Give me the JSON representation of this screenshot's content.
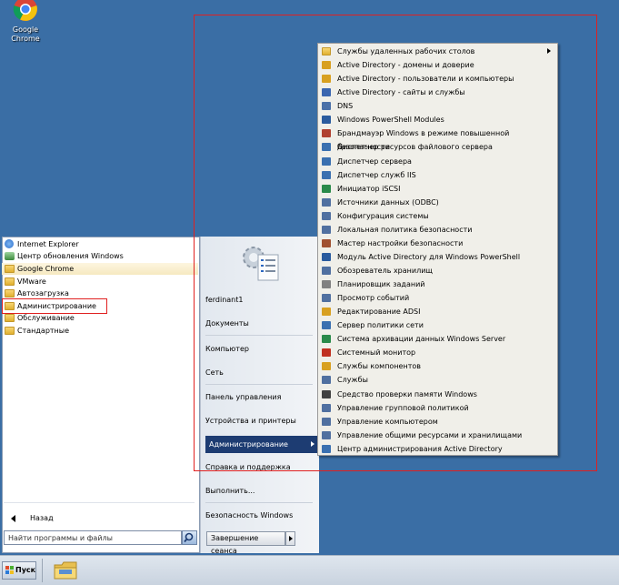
{
  "desktop": {
    "icons": [
      {
        "label": "Google\nChrome",
        "label_line1": "Google",
        "label_line2": "Chrome",
        "icon": "chrome-icon"
      }
    ]
  },
  "start_menu": {
    "programs": [
      {
        "label": "Internet Explorer",
        "icon": "ie-icon",
        "color": "#2b6fcf"
      },
      {
        "label": "Центр обновления Windows",
        "icon": "windows-update-icon",
        "color": "#3c8a3c"
      },
      {
        "label": "Google Chrome",
        "icon": "folder-icon",
        "color": "#e8c050"
      },
      {
        "label": "VMware",
        "icon": "folder-icon",
        "color": "#e8c050"
      },
      {
        "label": "Автозагрузка",
        "icon": "folder-icon",
        "color": "#e8c050"
      },
      {
        "label": "Администрирование",
        "icon": "folder-icon",
        "color": "#e8c050"
      },
      {
        "label": "Обслуживание",
        "icon": "folder-icon",
        "color": "#e8c050"
      },
      {
        "label": "Стандартные",
        "icon": "folder-icon",
        "color": "#e8c050"
      }
    ],
    "back_label": "Назад",
    "search_placeholder": "Найти программы и файлы",
    "right_items": [
      "ferdinant1",
      "Документы",
      "Компьютер",
      "Сеть",
      "Панель управления",
      "Устройства и принтеры",
      "Администрирование",
      "Справка и поддержка",
      "Выполнить...",
      "Безопасность Windows"
    ],
    "shutdown_label": "Завершение сеанса"
  },
  "submenu": {
    "items": [
      {
        "label": "Службы удаленных рабочих столов",
        "icon": "folder-icon",
        "color": "#e8c050",
        "has_arrow": true
      },
      {
        "label": "Active Directory - домены и доверие",
        "icon": "ad-domains-icon",
        "color": "#d8a020"
      },
      {
        "label": "Active Directory - пользователи и компьютеры",
        "icon": "ad-users-icon",
        "color": "#d8a020"
      },
      {
        "label": "Active Directory - сайты и службы",
        "icon": "ad-sites-icon",
        "color": "#3a66b0"
      },
      {
        "label": "DNS",
        "icon": "dns-icon",
        "color": "#4a70a8"
      },
      {
        "label": "Windows PowerShell Modules",
        "icon": "powershell-icon",
        "color": "#2a5b9e"
      },
      {
        "label": "Брандмауэр Windows в режиме повышенной безопасности",
        "icon": "firewall-icon",
        "color": "#b04030"
      },
      {
        "label": "Диспетчер ресурсов файлового сервера",
        "icon": "file-server-icon",
        "color": "#3a70b0"
      },
      {
        "label": "Диспетчер сервера",
        "icon": "server-manager-icon",
        "color": "#3a70b0"
      },
      {
        "label": "Диспетчер служб IIS",
        "icon": "iis-icon",
        "color": "#3a70b0"
      },
      {
        "label": "Инициатор iSCSI",
        "icon": "iscsi-icon",
        "color": "#2a8a4a"
      },
      {
        "label": "Источники данных (ODBC)",
        "icon": "odbc-icon",
        "color": "#5070a0"
      },
      {
        "label": "Конфигурация системы",
        "icon": "msconfig-icon",
        "color": "#5070a0"
      },
      {
        "label": "Локальная политика безопасности",
        "icon": "local-security-icon",
        "color": "#5070a0"
      },
      {
        "label": "Мастер настройки безопасности",
        "icon": "security-wizard-icon",
        "color": "#a05030"
      },
      {
        "label": "Модуль Active Directory для Windows PowerShell",
        "icon": "ad-powershell-icon",
        "color": "#2a5b9e"
      },
      {
        "label": "Обозреватель хранилищ",
        "icon": "storage-explorer-icon",
        "color": "#5070a0"
      },
      {
        "label": "Планировщик заданий",
        "icon": "task-scheduler-icon",
        "color": "#808080"
      },
      {
        "label": "Просмотр событий",
        "icon": "event-viewer-icon",
        "color": "#5070a0"
      },
      {
        "label": "Редактирование ADSI",
        "icon": "adsi-icon",
        "color": "#d8a020"
      },
      {
        "label": "Сервер политики сети",
        "icon": "nps-icon",
        "color": "#3a70b0"
      },
      {
        "label": "Система архивации данных Windows Server",
        "icon": "backup-icon",
        "color": "#2a8a4a"
      },
      {
        "label": "Системный монитор",
        "icon": "perfmon-icon",
        "color": "#c03020"
      },
      {
        "label": "Службы компонентов",
        "icon": "component-services-icon",
        "color": "#d8a020"
      },
      {
        "label": "Службы",
        "icon": "services-icon",
        "color": "#5070a0"
      },
      {
        "label": "Средство проверки памяти Windows",
        "icon": "memory-diag-icon",
        "color": "#404040"
      },
      {
        "label": "Управление групповой политикой",
        "icon": "gpmc-icon",
        "color": "#5070a0"
      },
      {
        "label": "Управление компьютером",
        "icon": "compmgmt-icon",
        "color": "#5070a0"
      },
      {
        "label": "Управление общими ресурсами и хранилищами",
        "icon": "share-storage-icon",
        "color": "#5070a0"
      },
      {
        "label": "Центр администрирования Active Directory",
        "icon": "ad-admin-center-icon",
        "color": "#3a70b0"
      }
    ]
  },
  "taskbar": {
    "start_label": "Пуск"
  }
}
